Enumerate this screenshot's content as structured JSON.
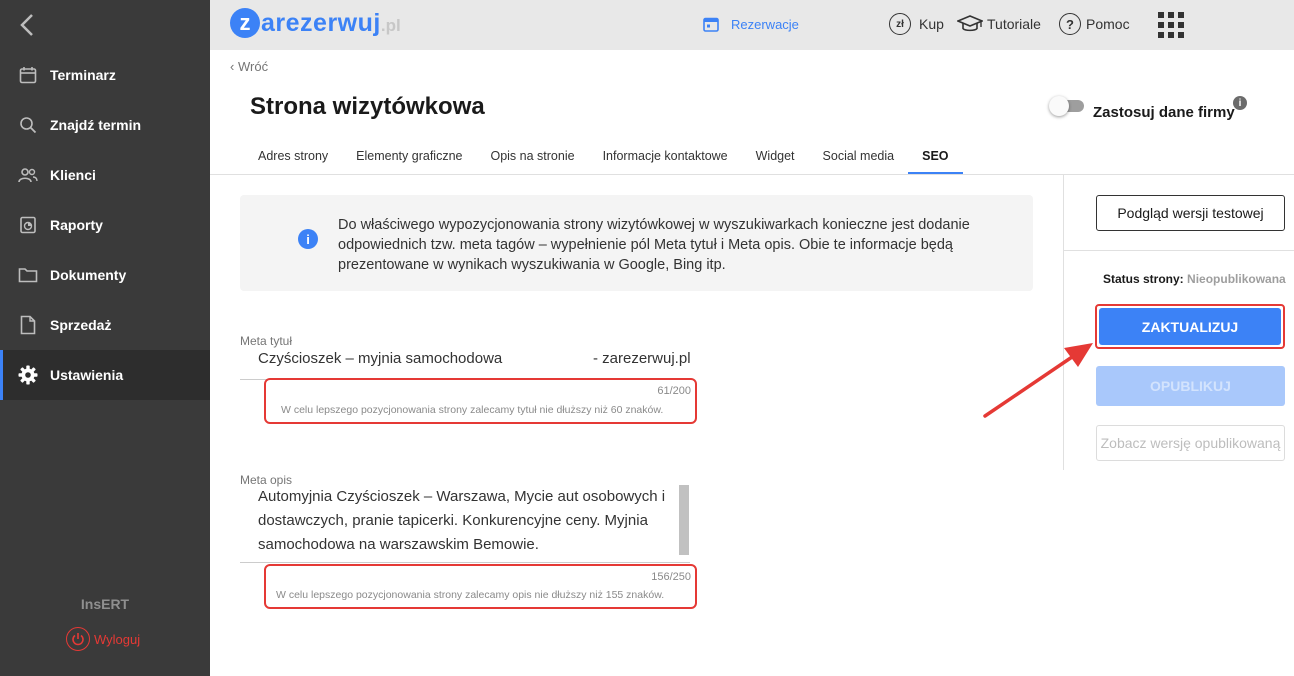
{
  "sidebar": {
    "items": [
      {
        "label": "Terminarz",
        "icon": "calendar-icon"
      },
      {
        "label": "Znajdź termin",
        "icon": "search-icon"
      },
      {
        "label": "Klienci",
        "icon": "people-icon"
      },
      {
        "label": "Raporty",
        "icon": "report-icon"
      },
      {
        "label": "Dokumenty",
        "icon": "folder-icon"
      },
      {
        "label": "Sprzedaż",
        "icon": "document-icon"
      },
      {
        "label": "Ustawienia",
        "icon": "gear-icon",
        "active": true
      }
    ],
    "brand": "InsERT",
    "logout": "Wyloguj"
  },
  "topbar": {
    "logo_z": "z",
    "logo_text": "arezerwuj",
    "logo_suffix": ".pl",
    "reservations": "Rezerwacje",
    "buy": "Kup",
    "buy_icon_text": "zł",
    "tutorials": "Tutoriale",
    "help": "Pomoc"
  },
  "header": {
    "back": "Wróć",
    "title": "Strona wizytówkowa",
    "toggle_label": "Zastosuj dane firmy"
  },
  "tabs": [
    {
      "label": "Adres strony"
    },
    {
      "label": "Elementy graficzne"
    },
    {
      "label": "Opis na stronie"
    },
    {
      "label": "Informacje kontaktowe"
    },
    {
      "label": "Widget"
    },
    {
      "label": "Social media"
    },
    {
      "label": "SEO",
      "active": true
    }
  ],
  "info": {
    "text": "Do właściwego wypozycjonowania strony wizytówkowej w wyszukiwarkach konieczne jest dodanie odpowiednich tzw. meta tagów – wypełnienie pól Meta tytuł i Meta opis. Obie te informacje będą prezentowane w wynikach wyszukiwania w Google, Bing itp."
  },
  "meta_title": {
    "label": "Meta tytuł",
    "value": "Czyścioszek – myjnia samochodowa",
    "suffix": "- zarezerwuj.pl",
    "count": "61/200",
    "hint": "W celu lepszego pozycjonowania strony zalecamy tytuł nie dłuższy niż 60 znaków."
  },
  "meta_desc": {
    "label": "Meta opis",
    "value": "Automyjnia Czyścioszek – Warszawa, Mycie aut osobowych i dostawczych, pranie tapicerki. Konkurencyjne ceny. Myjnia samochodowa na warszawskim Bemowie.",
    "count": "156/250",
    "hint": "W celu lepszego pozycjonowania strony zalecamy opis nie dłuższy niż 155 znaków."
  },
  "right_panel": {
    "preview": "Podgląd wersji testowej",
    "status_label": "Status strony:",
    "status_value": "Nieopublikowana",
    "update": "ZAKTUALIZUJ",
    "publish": "OPUBLIKUJ",
    "view_published": "Zobacz wersję opublikowaną"
  },
  "colors": {
    "accent": "#3c82f6",
    "sidebar": "#3a3a3a",
    "highlight": "#e53935"
  }
}
